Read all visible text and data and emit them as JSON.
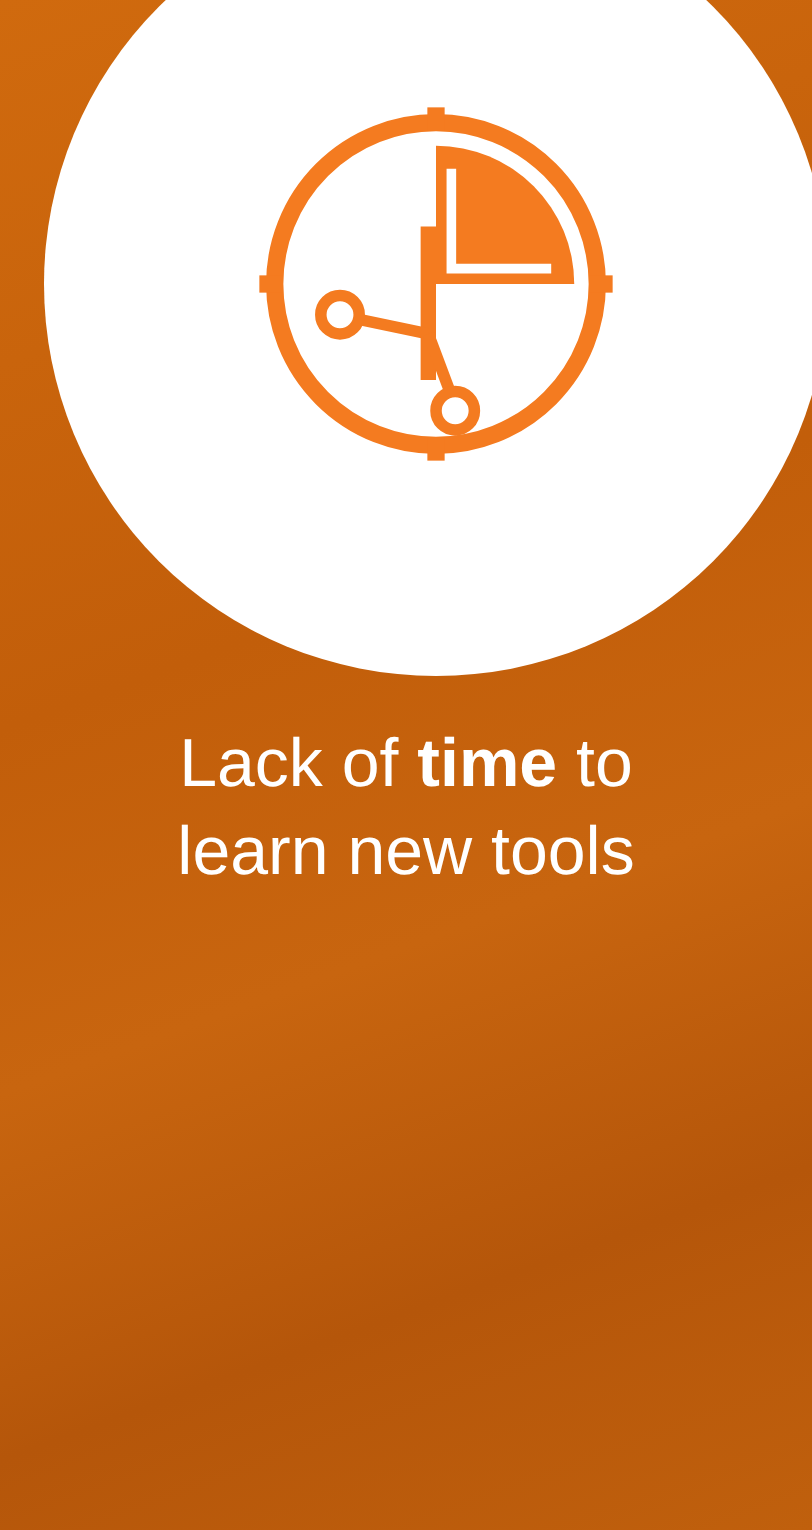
{
  "headline": "Lack of **time** to learn new tools"
}
